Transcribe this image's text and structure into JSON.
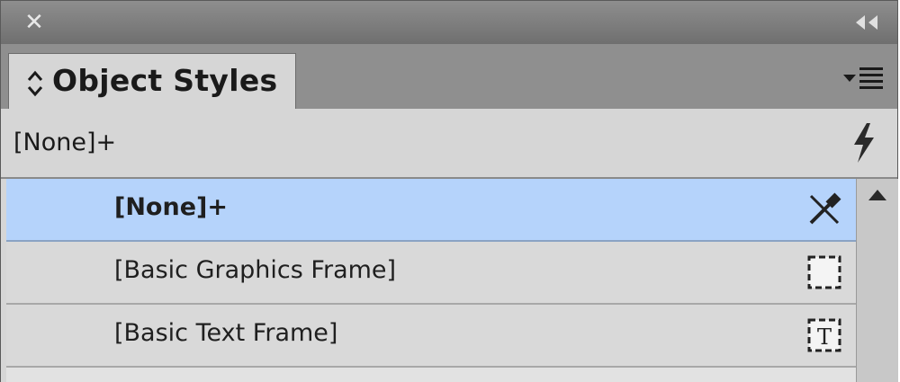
{
  "panel": {
    "title": "Object Styles",
    "current_style": "[None]+"
  },
  "styles": [
    {
      "label": "[None]+",
      "icon": "no-style-eyedropper-icon",
      "selected": true
    },
    {
      "label": "[Basic Graphics Frame]",
      "icon": "graphics-frame-icon",
      "selected": false
    },
    {
      "label": "[Basic Text Frame]",
      "icon": "text-frame-icon",
      "selected": false
    }
  ],
  "colors": {
    "selection": "#b5d3fb",
    "panel_bg": "#d6d6d6",
    "titlebar": "#7a7a7a"
  }
}
